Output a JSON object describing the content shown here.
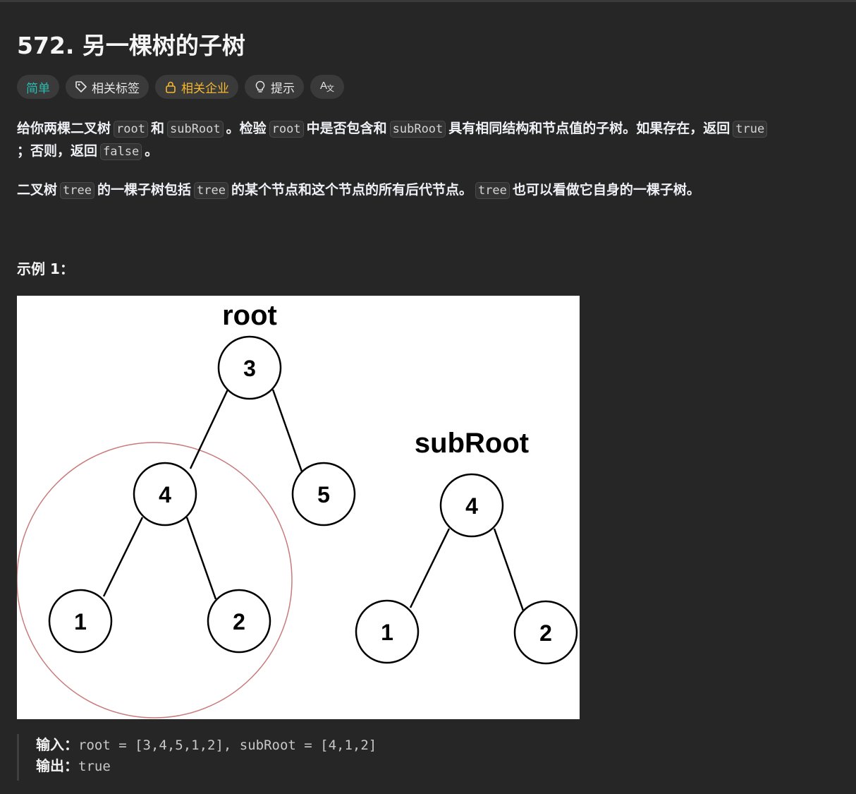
{
  "problem": {
    "title": "572. 另一棵树的子树"
  },
  "tags": {
    "difficulty": "简单",
    "related_tags": "相关标签",
    "related_companies": "相关企业",
    "hint": "提示",
    "translate_icon": "translate-icon"
  },
  "description": {
    "p1": {
      "t1": "给你两棵二叉树",
      "c1": "root",
      "t2": "和",
      "c2": "subRoot",
      "t3": "。检验",
      "c3": "root",
      "t4": "中是否包含和",
      "c4": "subRoot",
      "t5": "具有相同结构和节点值的子树。如果存在，返回",
      "c5": "true",
      "t6": "；否则，返回",
      "c6": "false",
      "t7": "。"
    },
    "p2": {
      "t1": "二叉树",
      "c1": "tree",
      "t2": "的一棵子树包括",
      "c2": "tree",
      "t3": "的某个节点和这个节点的所有后代节点。",
      "c3": "tree",
      "t4": "也可以看做它自身的一棵子树。"
    }
  },
  "example": {
    "title": "示例 1：",
    "figure": {
      "root_label": "root",
      "subroot_label": "subRoot",
      "root_nodes": [
        "3",
        "4",
        "5",
        "1",
        "2"
      ],
      "subroot_nodes": [
        "4",
        "1",
        "2"
      ],
      "highlight_color": "#c97a7a"
    },
    "input_label": "输入：",
    "input_value": "root = [3,4,5,1,2], subRoot = [4,1,2]",
    "output_label": "输出：",
    "output_value": "true"
  },
  "colors": {
    "background": "#262626",
    "easy": "#2cbbb0",
    "company": "#f5b82e"
  }
}
